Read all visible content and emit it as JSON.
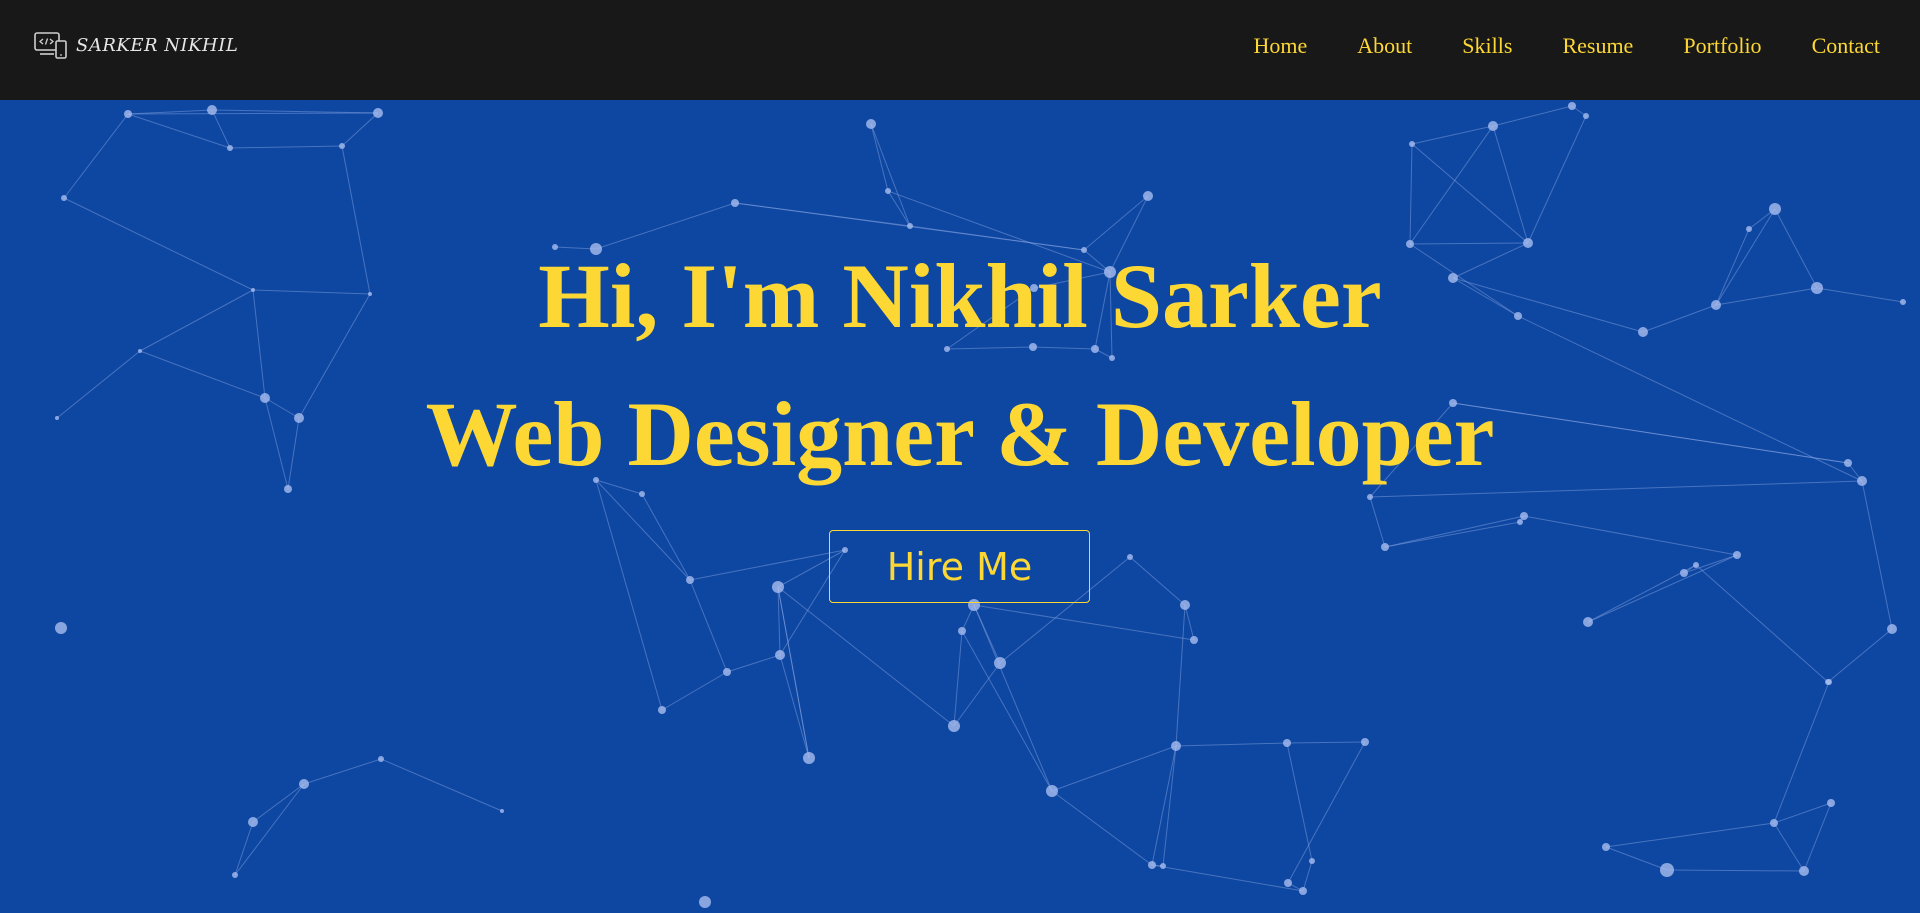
{
  "nav": {
    "brand": {
      "name": "SARKER NIKHIL",
      "icon": "code-devices-icon"
    },
    "links": [
      {
        "label": "Home"
      },
      {
        "label": "About"
      },
      {
        "label": "Skills"
      },
      {
        "label": "Resume"
      },
      {
        "label": "Portfolio"
      },
      {
        "label": "Contact"
      }
    ]
  },
  "hero": {
    "greeting": "Hi, I'm Nikhil Sarker",
    "role": "Web Designer & Developer",
    "cta_label": "Hire Me"
  },
  "colors": {
    "background": "#0e47a1",
    "navbar": "#181818",
    "accent": "#fdd835",
    "particle": "#8fa9e6"
  }
}
